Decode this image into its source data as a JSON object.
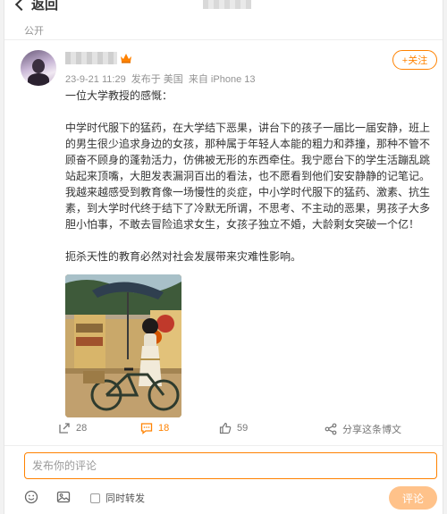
{
  "header": {
    "back_label": "返回"
  },
  "post": {
    "visibility": "公开",
    "meta": {
      "timestamp": "23-9-21 11:29",
      "from_label": "发布于 美国",
      "device": "来自 iPhone 13"
    },
    "follow_label": "+关注",
    "paragraphs": [
      "一位大学教授的感慨：",
      "中学时代服下的猛药，在大学结下恶果，讲台下的孩子一届比一届安静，班上的男生很少追求身边的女孩，那种属于年轻人本能的粗力和莽撞，那种不管不顾奋不顾身的蓬勃活力，仿佛被无形的东西牵住。我宁愿台下的学生活蹦乱跳站起来顶嘴，大胆发表漏洞百出的看法，也不愿看到他们安安静静的记笔记。我越来越感受到教育像一场慢性的炎症，中小学时代服下的猛药、激素、抗生素，到大学时代终于结下了冷默无所谓，不思考、不主动的恶果，男孩子大多胆小怕事，不敢去冒险追求女生，女孩子独立不婚，大龄剩女突破一个亿！",
      "扼杀天性的教育必然对社会发展带来灾难性影响。"
    ]
  },
  "actions": {
    "repost_count": "28",
    "comment_count": "18",
    "like_count": "59",
    "share_label": "分享这条博文"
  },
  "composer": {
    "placeholder": "发布你的评论",
    "repost_toggle_label": "同时转发",
    "submit_label": "评论"
  },
  "colors": {
    "accent": "#ff8200",
    "submit_disabled": "#ffc28a",
    "meta_text": "#939393"
  }
}
